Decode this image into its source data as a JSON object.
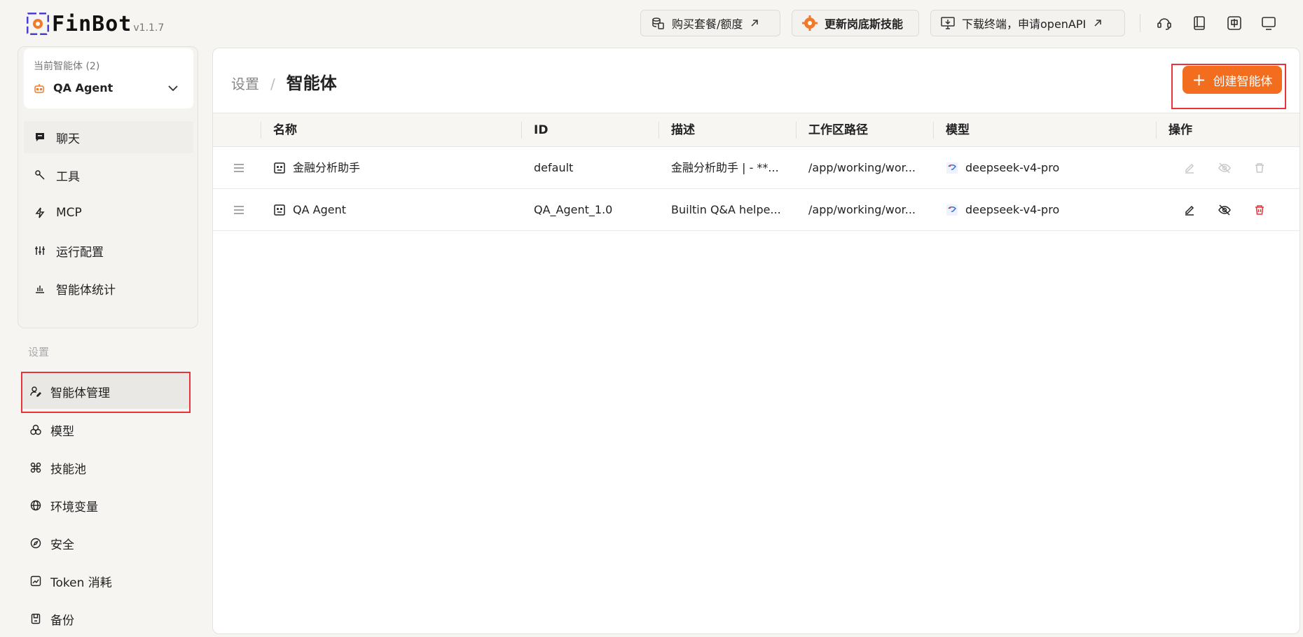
{
  "app": {
    "name": "FinBot",
    "version": "v1.1.7"
  },
  "header": {
    "buy_label": "购买套餐/额度",
    "skill_label": "更新岗底斯技能",
    "download_label": "下载终端，申请openAPI",
    "icons": [
      "support-icon",
      "book-icon",
      "language-icon",
      "monitor-icon"
    ]
  },
  "agent_selector": {
    "caption": "当前智能体 (2)",
    "current": "QA Agent"
  },
  "agent_nav": [
    {
      "label": "聊天",
      "icon": "chat-icon"
    },
    {
      "label": "工具",
      "icon": "wrench-icon"
    },
    {
      "label": "MCP",
      "icon": "lightning-icon"
    },
    {
      "label": "运行配置",
      "icon": "sliders-icon"
    },
    {
      "label": "智能体统计",
      "icon": "bar-chart-icon"
    }
  ],
  "settings_nav": {
    "section_label": "设置",
    "items": [
      {
        "label": "智能体管理",
        "icon": "user-edit-icon",
        "active": true
      },
      {
        "label": "模型",
        "icon": "model-icon"
      },
      {
        "label": "技能池",
        "icon": "command-icon"
      },
      {
        "label": "环境变量",
        "icon": "globe-icon"
      },
      {
        "label": "安全",
        "icon": "compass-icon"
      },
      {
        "label": "Token 消耗",
        "icon": "chart-box-icon"
      },
      {
        "label": "备份",
        "icon": "backup-icon"
      }
    ]
  },
  "main": {
    "breadcrumb_parent": "设置",
    "breadcrumb_current": "智能体",
    "create_label": "创建智能体",
    "columns": [
      "名称",
      "ID",
      "描述",
      "工作区路径",
      "模型",
      "操作"
    ],
    "rows": [
      {
        "name": "金融分析助手",
        "id": "default",
        "desc": "金融分析助手 | - **...",
        "path": "/app/working/wor...",
        "model": "deepseek-v4-pro",
        "actions_enabled": false
      },
      {
        "name": "QA Agent",
        "id": "QA_Agent_1.0",
        "desc": "Builtin Q&A helpe...",
        "path": "/app/working/wor...",
        "model": "deepseek-v4-pro",
        "actions_enabled": true
      }
    ]
  },
  "colors": {
    "accent": "#f26d1d",
    "danger": "#e8333a",
    "highlight_box": "#e8333a"
  }
}
